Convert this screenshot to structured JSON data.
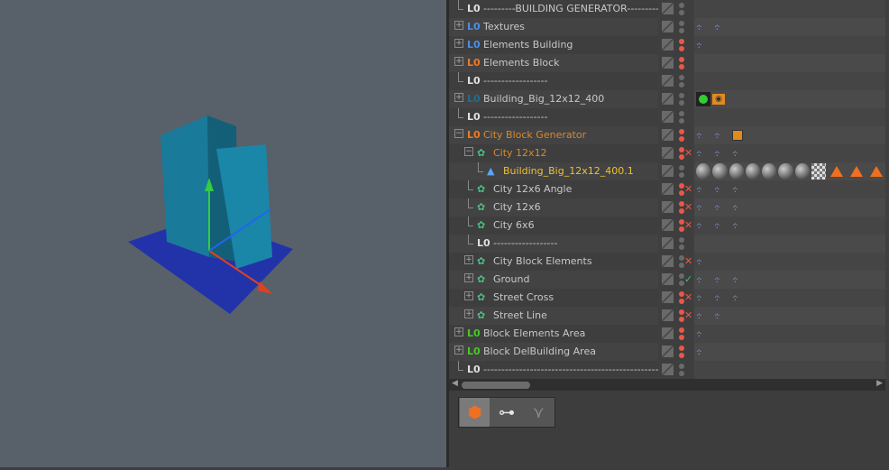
{
  "object_manager": {
    "rows": [
      {
        "name": "---------BUILDING GENERATOR---------",
        "depth": 0,
        "expand": "",
        "icon": "null-white",
        "color": "#c8c8c8",
        "dots": "grey",
        "status": "",
        "tags": []
      },
      {
        "name": "Textures",
        "depth": 0,
        "expand": "+",
        "icon": "null-blue",
        "color": "#c8c8c8",
        "dots": "grey",
        "status": "",
        "tags": [
          "hier",
          "hier"
        ]
      },
      {
        "name": "Elements Building",
        "depth": 0,
        "expand": "+",
        "icon": "null-blue",
        "color": "#c8c8c8",
        "dots": "red",
        "status": "",
        "tags": [
          "hier"
        ]
      },
      {
        "name": "Elements Block",
        "depth": 0,
        "expand": "+",
        "icon": "null-orange",
        "color": "#c8c8c8",
        "dots": "red",
        "status": "",
        "tags": []
      },
      {
        "name": "------------------",
        "depth": 0,
        "expand": "",
        "icon": "null-white",
        "color": "#c8c8c8",
        "dots": "grey",
        "status": "",
        "tags": []
      },
      {
        "name": "Building_Big_12x12_400",
        "depth": 0,
        "expand": "+",
        "icon": "null-teal",
        "color": "#c8c8c8",
        "dots": "grey",
        "status": "",
        "tags": [
          "green-sphere",
          "display-eye"
        ]
      },
      {
        "name": "------------------",
        "depth": 0,
        "expand": "",
        "icon": "null-white",
        "color": "#c8c8c8",
        "dots": "grey",
        "status": "",
        "tags": []
      },
      {
        "name": "City Block Generator",
        "depth": 0,
        "expand": "-",
        "icon": "null-orange",
        "color": "#d9892b",
        "dots": "red",
        "status": "",
        "tags": [
          "hier",
          "hier",
          "orange-tag"
        ]
      },
      {
        "name": "City 12x12",
        "depth": 1,
        "expand": "-",
        "icon": "cloner",
        "color": "#d9892b",
        "dots": "red",
        "status": "x",
        "tags": [
          "hier",
          "hier",
          "hier"
        ]
      },
      {
        "name": "Building_Big_12x12_400.1",
        "depth": 2,
        "expand": "",
        "icon": "instance",
        "color": "#f0c030",
        "dots": "grey",
        "status": "",
        "tags": [
          "mat",
          "mat",
          "mat",
          "mat",
          "mat",
          "mat",
          "mat",
          "checker",
          "tri",
          "tri",
          "tri"
        ]
      },
      {
        "name": "City 12x6 Angle",
        "depth": 1,
        "expand": "",
        "icon": "cloner",
        "color": "#c8c8c8",
        "dots": "red",
        "status": "x",
        "tags": [
          "hier",
          "hier",
          "hier"
        ]
      },
      {
        "name": "City 12x6",
        "depth": 1,
        "expand": "",
        "icon": "cloner",
        "color": "#c8c8c8",
        "dots": "red",
        "status": "x",
        "tags": [
          "hier",
          "hier",
          "hier"
        ]
      },
      {
        "name": "City 6x6",
        "depth": 1,
        "expand": "",
        "icon": "cloner",
        "color": "#c8c8c8",
        "dots": "red",
        "status": "x",
        "tags": [
          "hier",
          "hier",
          "hier"
        ]
      },
      {
        "name": "------------------",
        "depth": 1,
        "expand": "",
        "icon": "null-white",
        "color": "#c8c8c8",
        "dots": "grey",
        "status": "",
        "tags": []
      },
      {
        "name": "City Block Elements",
        "depth": 1,
        "expand": "+",
        "icon": "cloner",
        "color": "#c8c8c8",
        "dots": "grey",
        "status": "x",
        "tags": [
          "hier"
        ]
      },
      {
        "name": "Ground",
        "depth": 1,
        "expand": "+",
        "icon": "cloner",
        "color": "#c8c8c8",
        "dots": "grey",
        "status": "check",
        "tags": [
          "hier",
          "hier",
          "hier"
        ]
      },
      {
        "name": "Street Cross",
        "depth": 1,
        "expand": "+",
        "icon": "cloner",
        "color": "#c8c8c8",
        "dots": "red",
        "status": "x",
        "tags": [
          "hier",
          "hier",
          "hier"
        ]
      },
      {
        "name": "Street Line",
        "depth": 1,
        "expand": "+",
        "icon": "cloner",
        "color": "#c8c8c8",
        "dots": "red",
        "status": "x",
        "tags": [
          "hier",
          "hier"
        ]
      },
      {
        "name": "Block Elements Area",
        "depth": 0,
        "expand": "+",
        "icon": "null-green",
        "color": "#c8c8c8",
        "dots": "red",
        "status": "",
        "tags": [
          "hier"
        ]
      },
      {
        "name": "Block DelBuilding Area",
        "depth": 0,
        "expand": "+",
        "icon": "null-green",
        "color": "#c8c8c8",
        "dots": "red",
        "status": "",
        "tags": [
          "hier"
        ]
      },
      {
        "name": "-------------------------------------------------",
        "depth": 0,
        "expand": "",
        "icon": "null-white",
        "color": "#c8c8c8",
        "dots": "grey",
        "status": "",
        "tags": []
      }
    ]
  },
  "colors": {
    "viewport": "#58606a",
    "building": "#1a7a9a",
    "ground": "#2233aa",
    "selected_text": "#f0c030",
    "active_text": "#d9892b"
  },
  "toolbar": {
    "buttons": [
      "object-mode-icon",
      "hierarchy-tool-icon",
      "connect-tool-icon"
    ]
  }
}
